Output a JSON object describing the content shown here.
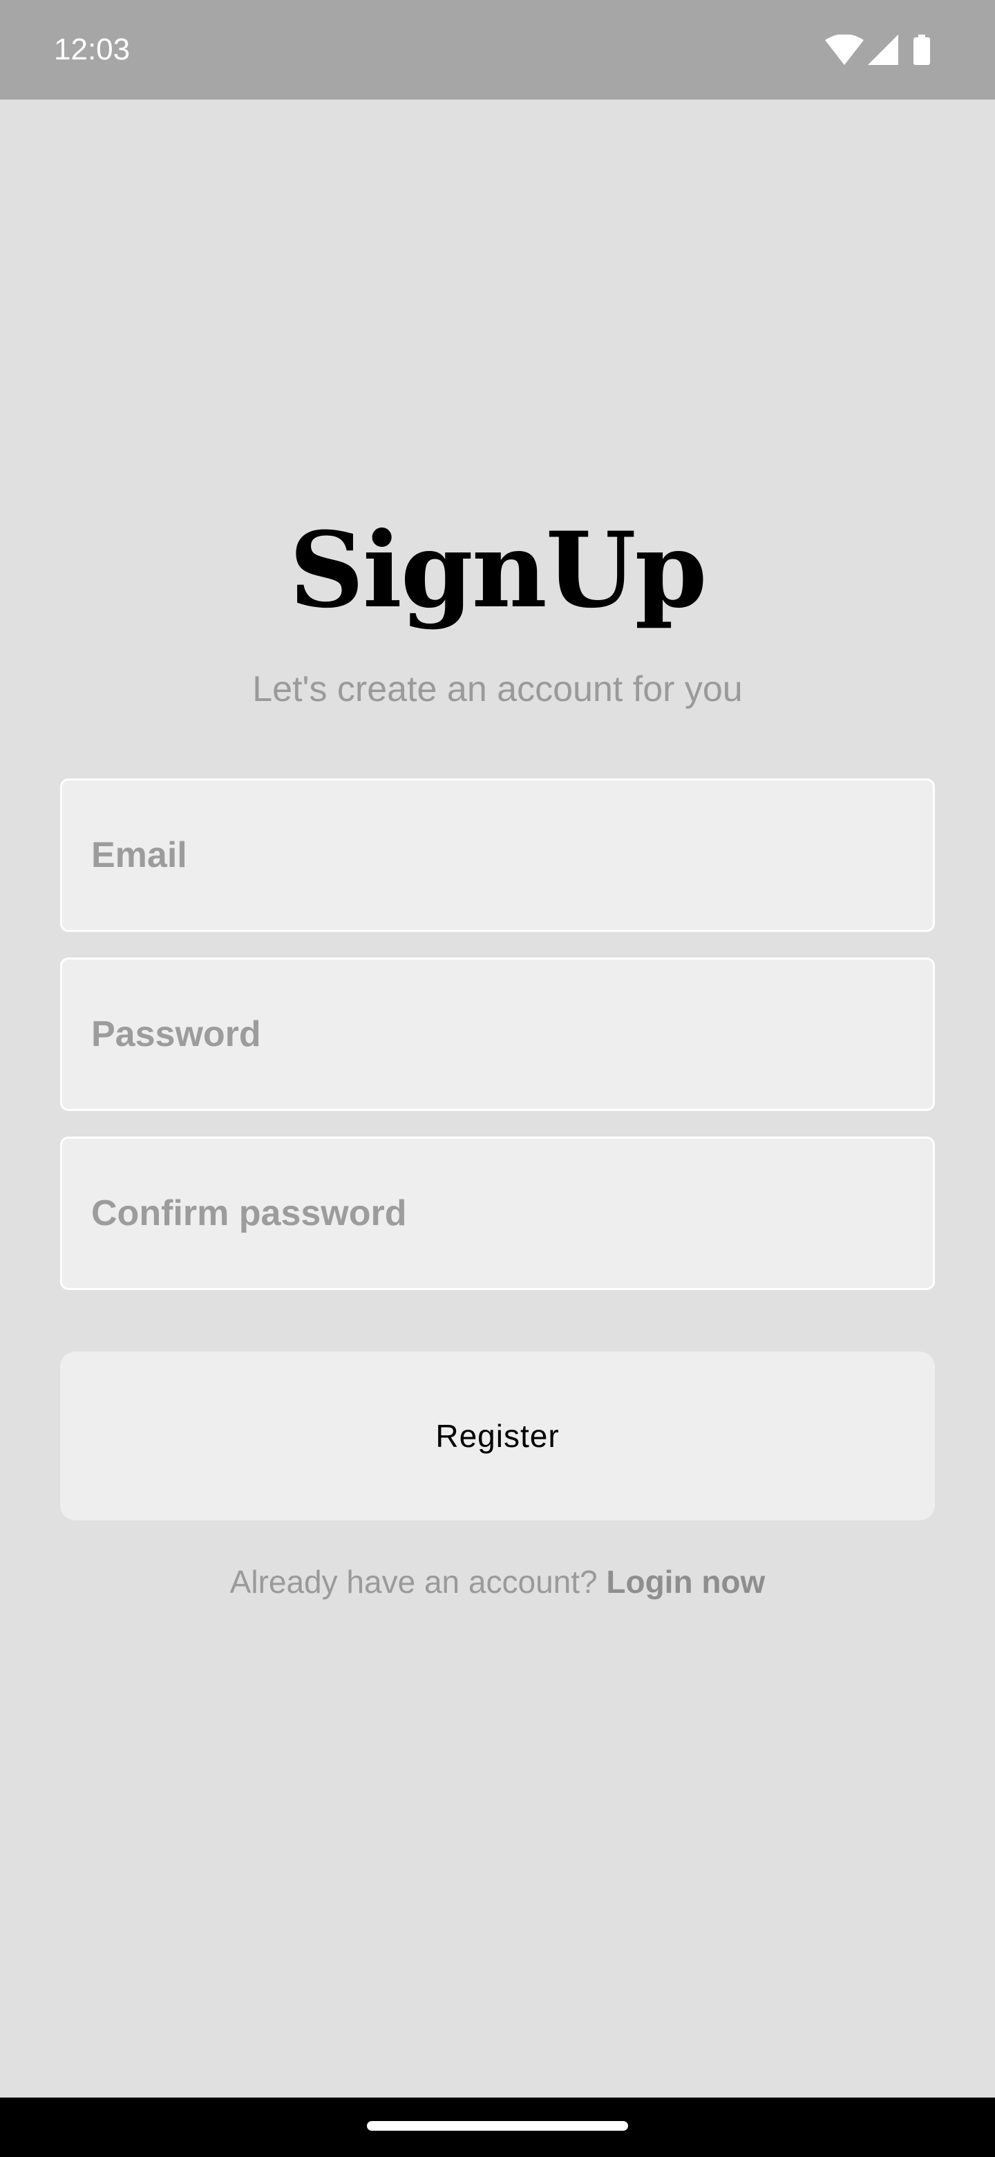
{
  "status_bar": {
    "time": "12:03",
    "icons": [
      "wifi-icon",
      "signal-icon",
      "battery-icon"
    ]
  },
  "header": {
    "title": "SignUp",
    "subtitle": "Let's create an account for you"
  },
  "form": {
    "email_placeholder": "Email",
    "email_value": "",
    "password_placeholder": "Password",
    "password_value": "",
    "confirm_password_placeholder": "Confirm password",
    "confirm_password_value": "",
    "register_label": "Register"
  },
  "footer": {
    "prompt_text": "Already have an account?",
    "login_link_label": "Login now"
  },
  "colors": {
    "background": "#e0e0e0",
    "status_bar": "#a6a6a6",
    "field_background": "#eeeeee",
    "field_border": "#ffffff",
    "muted_text": "#9a9a9a",
    "nav_bar": "#000000"
  }
}
